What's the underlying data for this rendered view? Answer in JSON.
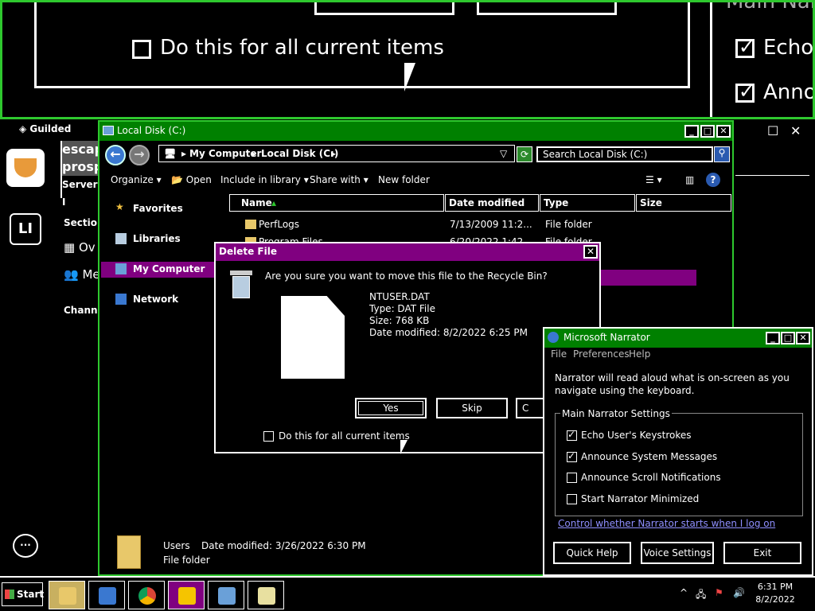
{
  "magnifier": {
    "checkbox_label": "Do this for all current items",
    "right_item1": "Echo U",
    "right_item2": "Annou",
    "right_group_fragment": "Main Narra"
  },
  "guilded": {
    "brand": "Guilded",
    "server_name_line1": "escap",
    "server_name_line2": "prosp",
    "server_badge": "Server I",
    "user_initials": "LI",
    "sections_label": "Section",
    "overview_label": "Ov",
    "members_label": "Me",
    "channels_label": "Channe"
  },
  "explorer": {
    "title": "Local Disk (C:)",
    "breadcrumb": [
      "My Computer",
      "Local Disk (C:)"
    ],
    "search_placeholder": "Search Local Disk (C:)",
    "toolbar": {
      "organize": "Organize",
      "open": "Open",
      "include_in_library": "Include in library",
      "share_with": "Share with",
      "new_folder": "New folder"
    },
    "columns": [
      "Name",
      "Date modified",
      "Type",
      "Size"
    ],
    "nav": [
      "Favorites",
      "Libraries",
      "My Computer",
      "Network"
    ],
    "rows": [
      {
        "name": "PerfLogs",
        "date": "7/13/2009 11:2...",
        "type": "File folder"
      },
      {
        "name": "Program Files",
        "date": "6/20/2022 1:42...",
        "type": "File folder"
      }
    ],
    "details": {
      "name": "Users",
      "date_modified": "Date modified:  3/26/2022 6:30 PM",
      "type": "File folder"
    }
  },
  "delete_dialog": {
    "title": "Delete File",
    "question": "Are you sure you want to move this file to the Recycle Bin?",
    "file_name": "NTUSER.DAT",
    "file_type": "Type: DAT File",
    "file_size": "Size: 768 KB",
    "file_date": "Date modified: 8/2/2022 6:25 PM",
    "yes": "Yes",
    "skip": "Skip",
    "cancel": "C",
    "checkbox_label": "Do this for all current items"
  },
  "narrator": {
    "title": "Microsoft Narrator",
    "menu": [
      "File",
      "Preferences",
      "Help"
    ],
    "description": "Narrator will read aloud what is on-screen as you navigate using the keyboard.",
    "group_label": "Main Narrator Settings",
    "options": [
      {
        "label": "Echo User's Keystrokes",
        "checked": true
      },
      {
        "label": "Announce System Messages",
        "checked": true
      },
      {
        "label": "Announce Scroll Notifications",
        "checked": false
      },
      {
        "label": "Start Narrator Minimized",
        "checked": false
      }
    ],
    "link": "Control whether Narrator starts when I log on",
    "quick_help": "Quick Help",
    "voice_settings": "Voice Settings",
    "exit": "Exit"
  },
  "taskbar": {
    "start": "Start",
    "time": "6:31 PM",
    "date": "8/2/2022"
  }
}
